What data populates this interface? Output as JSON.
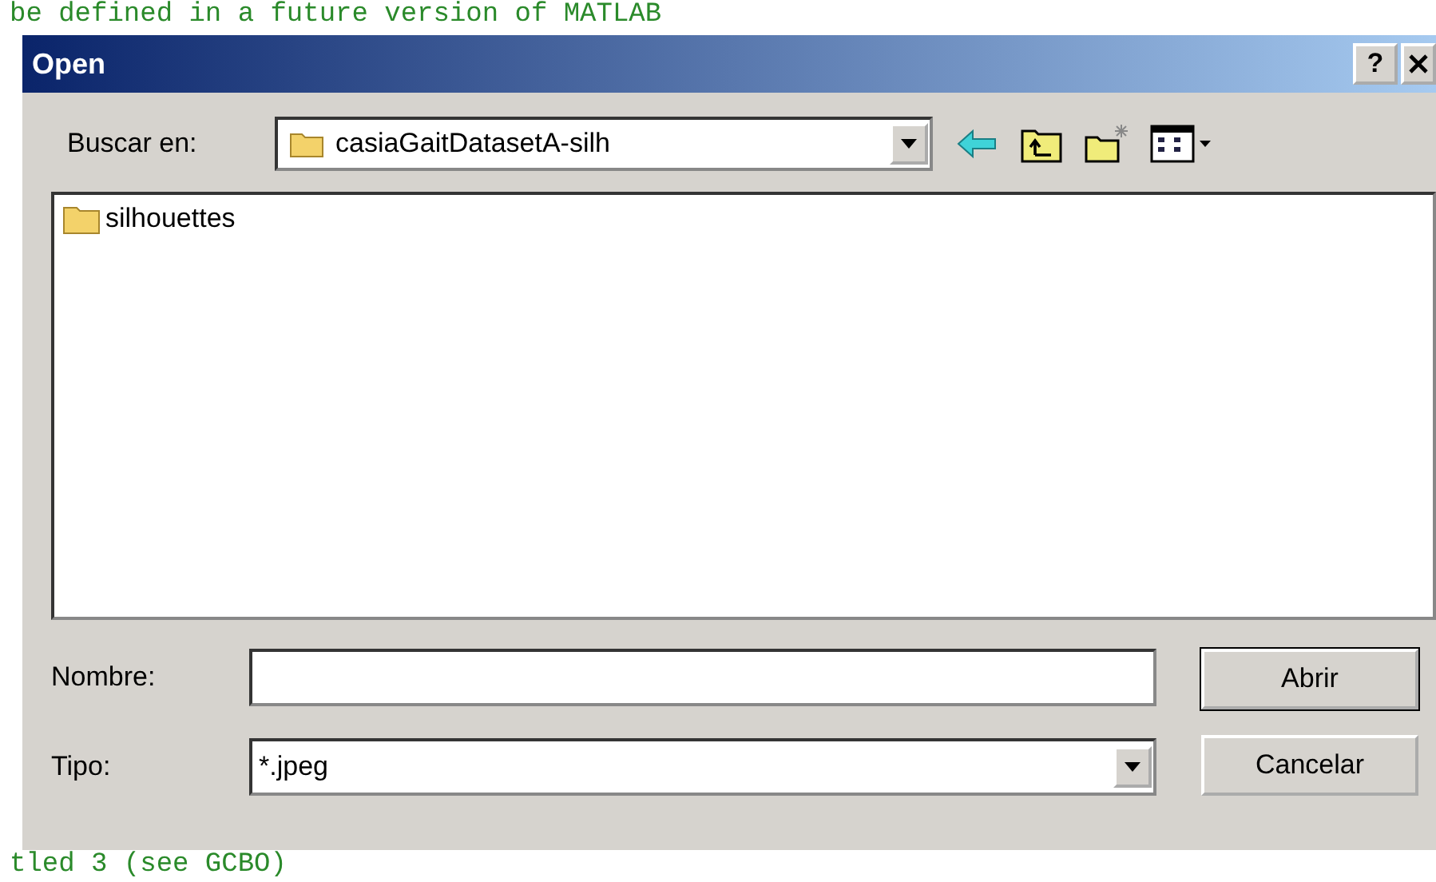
{
  "background_text": {
    "top": "be defined in a future version of MATLAB",
    "bottom": "tled 3 (see GCBO)"
  },
  "window": {
    "title": "Open",
    "help": "?"
  },
  "look_in": {
    "label": "Buscar en:",
    "value": "casiaGaitDatasetA-silh"
  },
  "files": [
    {
      "name": "silhouettes",
      "kind": "folder"
    }
  ],
  "file_name": {
    "label": "Nombre:"
  },
  "file_type": {
    "label": "Tipo:",
    "value": "*.jpeg"
  },
  "buttons": [
    "Abrir",
    "Cancelar"
  ]
}
